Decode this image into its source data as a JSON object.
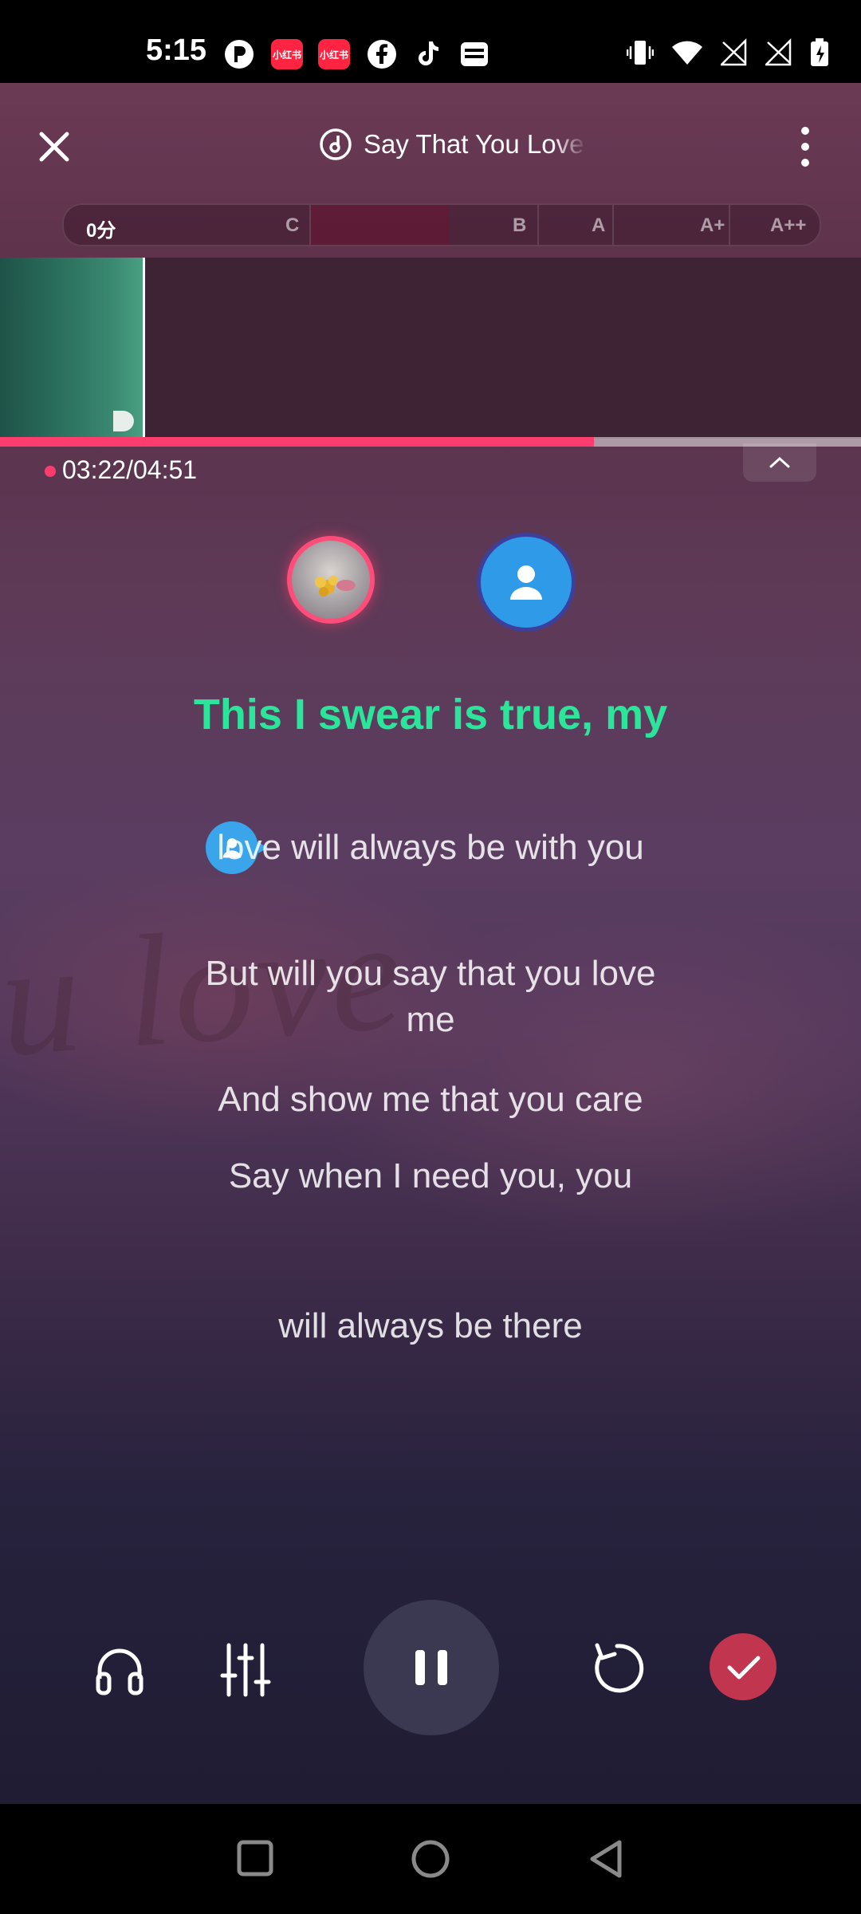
{
  "status_bar": {
    "time": "5:15",
    "apps": [
      {
        "name": "p-app-icon"
      },
      {
        "name": "xiaohongshu-icon",
        "label": "小红书"
      },
      {
        "name": "xiaohongshu-icon-2",
        "label": "小红书"
      },
      {
        "name": "facebook-icon"
      },
      {
        "name": "tiktok-icon"
      },
      {
        "name": "wallet-icon"
      }
    ]
  },
  "header": {
    "close_icon": "close-icon",
    "song_title": "Say That You Love Me",
    "more_icon": "more-vertical-icon"
  },
  "score_bar": {
    "current_score": "0分",
    "grades": [
      "C",
      "B",
      "A",
      "A+",
      "A++"
    ]
  },
  "playback": {
    "elapsed": "03:22",
    "total": "04:51",
    "time_display": "03:22/04:51",
    "progress": 0.69
  },
  "lyrics": {
    "current_line": "This I swear is true, my",
    "next_lines": [
      "love will always be with you",
      "But will you say that you love me",
      "And show me that you care",
      "Say when I need you, you",
      "will always be there"
    ]
  },
  "controls": {
    "headphones": "headphones-icon",
    "mixer": "equalizer-icon",
    "pause": "pause-icon",
    "restart": "restart-icon",
    "finish": "check-icon"
  },
  "colors": {
    "accent_pink": "#ff3c6e",
    "lyric_green": "#2be59b",
    "finish_red": "#c1364e",
    "singer_blue": "#2f9be8"
  }
}
